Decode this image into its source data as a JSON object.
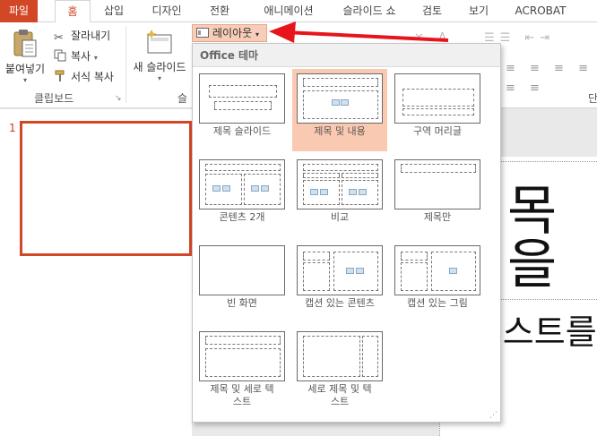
{
  "tabs": {
    "file": "파일",
    "home": "홈",
    "insert": "삽입",
    "design": "디자인",
    "transitions": "전환",
    "animations": "애니메이션",
    "slideshow": "슬라이드 쇼",
    "review": "검토",
    "view": "보기",
    "acrobat": "ACROBAT"
  },
  "clipboard": {
    "paste": "붙여넣기",
    "cut": "잘라내기",
    "copy": "복사",
    "format_painter": "서식 복사",
    "group_label": "클립보드"
  },
  "slides_group": {
    "new_slide": "새 슬라이드",
    "group_label_partial": "슬",
    "layout_button": "레이아웃"
  },
  "right_group_label_partial": "단",
  "thumbnails": {
    "slide_number": "1"
  },
  "slide": {
    "title_partial": "목을",
    "text_partial": "|스트를"
  },
  "gallery": {
    "header": "Office 테마",
    "layouts": [
      {
        "name": "제목 슬라이드"
      },
      {
        "name": "제목 및 내용",
        "selected": true
      },
      {
        "name": "구역 머리글"
      },
      {
        "name": "콘텐츠 2개"
      },
      {
        "name": "비교"
      },
      {
        "name": "제목만"
      },
      {
        "name": "빈 화면"
      },
      {
        "name": "캡션 있는 콘텐츠"
      },
      {
        "name": "캡션 있는 그림"
      },
      {
        "name": "제목 및 세로 텍스트"
      },
      {
        "name": "세로 제목 및 텍스트"
      }
    ]
  },
  "colors": {
    "accent": "#d24726",
    "selected": "#fac9b1",
    "arrow": "#e8141c"
  }
}
